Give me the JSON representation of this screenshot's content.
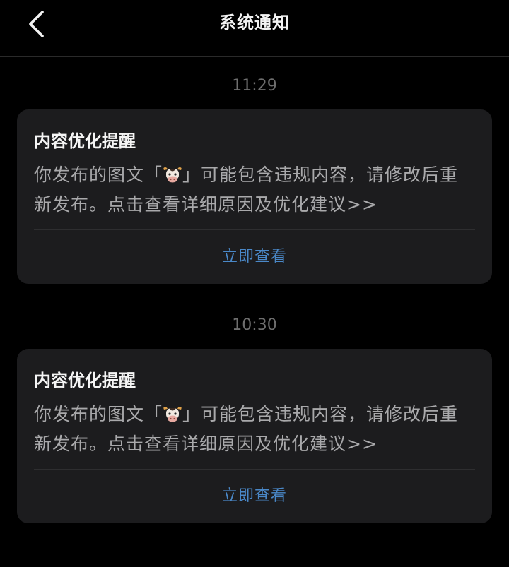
{
  "header": {
    "title": "系统通知",
    "back_icon": "chevron-left-icon"
  },
  "notifications": [
    {
      "time": "11:29",
      "title": "内容优化提醒",
      "body_before": "你发布的图文「",
      "emoji": "cow-face-icon",
      "body_after": "」可能包含违规内容，请修改后重新发布。点击查看详细原因及优化建议>>",
      "action_label": "立即查看"
    },
    {
      "time": "10:30",
      "title": "内容优化提醒",
      "body_before": "你发布的图文「",
      "emoji": "cow-face-icon",
      "body_after": "」可能包含违规内容，请修改后重新发布。点击查看详细原因及优化建议>>",
      "action_label": "立即查看"
    }
  ],
  "colors": {
    "background": "#000000",
    "card": "#1c1c1e",
    "title": "#f5f5f5",
    "body": "#a9a9ab",
    "timestamp": "#6e6e6e",
    "accent": "#4a88c8"
  }
}
